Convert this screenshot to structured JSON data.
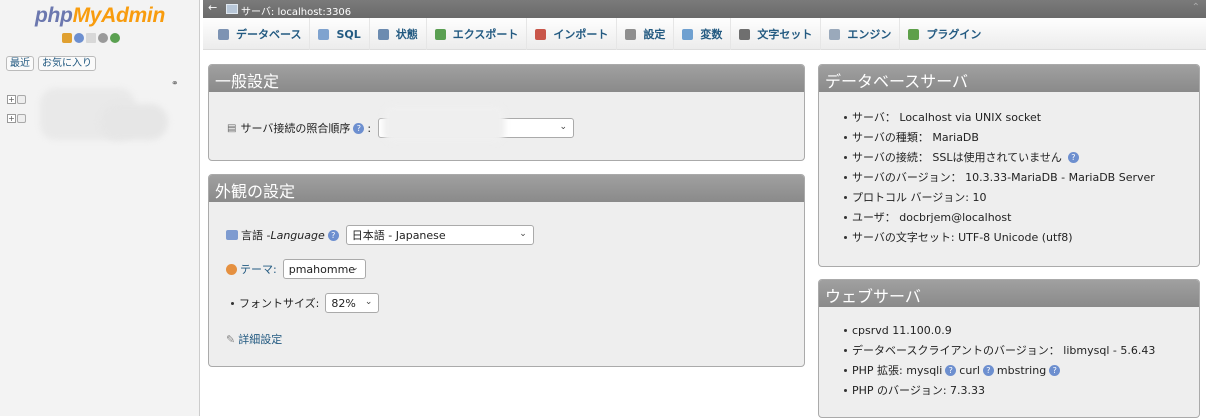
{
  "nav": {
    "logo_left": "php",
    "logo_right": "MyAdmin",
    "links": [
      "最近",
      "お気に入り"
    ]
  },
  "topbar": {
    "server_label": "サーバ: localhost:3306"
  },
  "tabs": [
    {
      "label": "データベース",
      "icon": "database-icon",
      "color": "#7d93b3"
    },
    {
      "label": "SQL",
      "icon": "sql-icon",
      "color": "#7fa3cf"
    },
    {
      "label": "状態",
      "icon": "status-icon",
      "color": "#6c8bb0"
    },
    {
      "label": "エクスポート",
      "icon": "export-icon",
      "color": "#5a9f52"
    },
    {
      "label": "インポート",
      "icon": "import-icon",
      "color": "#c9564a"
    },
    {
      "label": "設定",
      "icon": "wrench-icon",
      "color": "#8e8e8e"
    },
    {
      "label": "変数",
      "icon": "variables-icon",
      "color": "#6fa0d0"
    },
    {
      "label": "文字セット",
      "icon": "charset-icon",
      "color": "#6f6f6f"
    },
    {
      "label": "エンジン",
      "icon": "engine-icon",
      "color": "#9aa9bb"
    },
    {
      "label": "プラグイン",
      "icon": "plugin-icon",
      "color": "#5ea04a"
    }
  ],
  "general": {
    "title": "一般設定",
    "collation_label": "サーバ接続の照合順序",
    "collation_suffix": ":"
  },
  "appearance": {
    "title": "外観の設定",
    "language_label": "言語 - ",
    "language_label_em": "Language",
    "language_value": "日本語 - Japanese",
    "theme_label": "テーマ:",
    "theme_value": "pmahomme",
    "fontsize_label": "フォントサイズ:",
    "fontsize_value": "82%",
    "more_settings": "詳細設定"
  },
  "dbserver": {
    "title": "データベースサーバ",
    "items": [
      "サーバ： Localhost via UNIX socket",
      "サーバの種類： MariaDB",
      "サーバの接続： SSLは使用されていません",
      "サーバのバージョン： 10.3.33-MariaDB - MariaDB Server",
      "プロトコル バージョン: 10",
      "ユーザ： docbrjem@localhost",
      "サーバの文字セット: UTF-8 Unicode (utf8)"
    ]
  },
  "webserver": {
    "title": "ウェブサーバ",
    "items": [
      "cpsrvd 11.100.0.9",
      "データベースクライアントのバージョン： libmysql - 5.6.43"
    ],
    "php_ext_label": "PHP 拡張: mysqli",
    "php_ext_curl": "curl",
    "php_ext_mbstring": "mbstring",
    "php_version": "PHP のバージョン: 7.3.33"
  }
}
